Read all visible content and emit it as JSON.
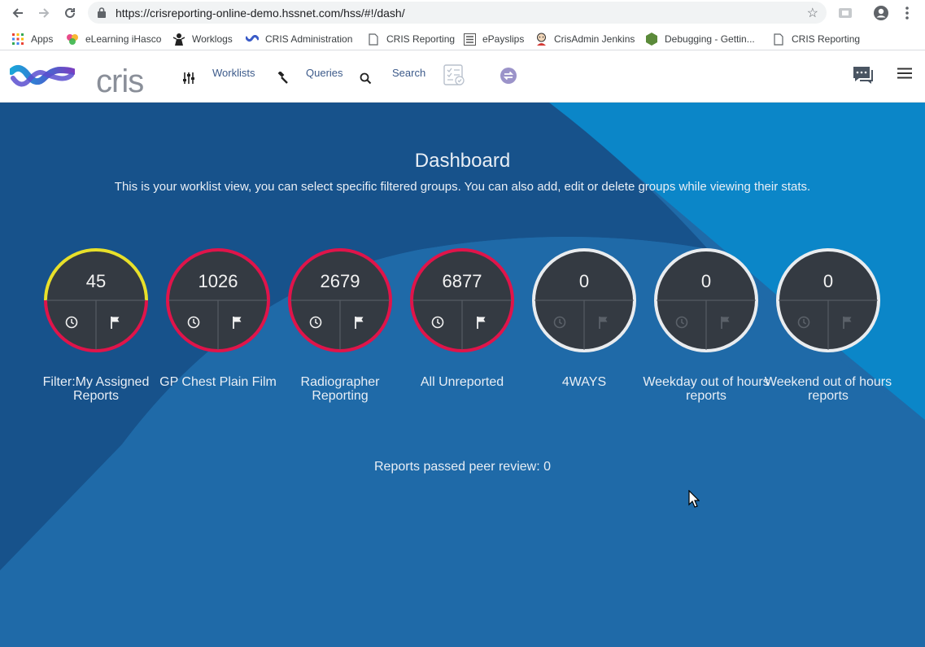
{
  "browser": {
    "url": "https://crisreporting-online-demo.hssnet.com/hss/#!/dash/",
    "bookmarks": [
      {
        "label": "Apps",
        "icon": "apps-grid-icon"
      },
      {
        "label": "eLearning iHasco",
        "icon": "ihasco-icon"
      },
      {
        "label": "Worklogs",
        "icon": "worklogs-icon"
      },
      {
        "label": "CRIS Administration",
        "icon": "cris-icon"
      },
      {
        "label": "CRIS Reporting",
        "icon": "page-icon"
      },
      {
        "label": "ePayslips",
        "icon": "epayslips-icon"
      },
      {
        "label": "CrisAdmin Jenkins",
        "icon": "jenkins-icon"
      },
      {
        "label": "Debugging - Gettin...",
        "icon": "hexagon-icon"
      },
      {
        "label": "CRIS Reporting",
        "icon": "page-icon"
      }
    ]
  },
  "app": {
    "logo_text": "cris",
    "nav": {
      "worklists": "Worklists",
      "queries": "Queries",
      "search": "Search"
    }
  },
  "dashboard": {
    "title": "Dashboard",
    "subtitle": "This is your worklist view, you can select specific filtered groups. You can also add, edit or delete groups while viewing their stats.",
    "tiles": [
      {
        "count": "45",
        "label": "Filter:My Assigned Reports",
        "ring": "mixed",
        "active": true
      },
      {
        "count": "1026",
        "label": "GP Chest Plain Film",
        "ring": "red",
        "active": true
      },
      {
        "count": "2679",
        "label": "Radiographer Reporting",
        "ring": "red",
        "active": true
      },
      {
        "count": "6877",
        "label": "All Unreported",
        "ring": "red",
        "active": true
      },
      {
        "count": "0",
        "label": "4WAYS",
        "ring": "white",
        "active": false
      },
      {
        "count": "0",
        "label": "Weekday out of hours reports",
        "ring": "white",
        "active": false
      },
      {
        "count": "0",
        "label": "Weekend out of hours reports",
        "ring": "white",
        "active": false
      }
    ],
    "peer_review": "Reports passed peer review: 0"
  },
  "colors": {
    "dash_bg": "#1f6aa8",
    "dash_dark": "#17528b",
    "dash_light": "#0b86c8",
    "ring_red": "#e0144a",
    "ring_yellow": "#e8e02a",
    "ring_white": "#e9ecef",
    "tile_fill": "#343a42"
  }
}
